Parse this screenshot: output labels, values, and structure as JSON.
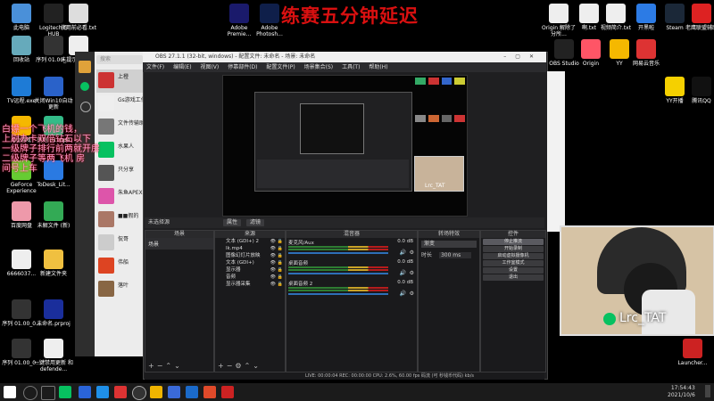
{
  "overlay": {
    "title": "练赛五分钟延迟"
  },
  "desktop_left": [
    {
      "label": "此电脑"
    },
    {
      "label": "Logitech G HUB"
    },
    {
      "label": "使用前必看.txt"
    },
    {
      "label": "回收站"
    },
    {
      "label": "序列 01.00_..."
    },
    {
      "label": "未提示页.mp4"
    },
    {
      "label": "TV远程.exe"
    },
    {
      "label": "关闭Win10自动更新"
    },
    {
      "label": "QQ游戏"
    },
    {
      "label": "序列 01.mp4"
    },
    {
      "label": "GeForce Experience"
    },
    {
      "label": "ToDesk_Lit..."
    },
    {
      "label": "百度网盘"
    },
    {
      "label": "未解文件 (新)"
    },
    {
      "label": "6666037..."
    },
    {
      "label": "新建文件夹"
    },
    {
      "label": "序列 01.00_0..."
    },
    {
      "label": "未命名.prproj"
    },
    {
      "label": "序列 01.00_0..."
    },
    {
      "label": "一键禁用更新 和defende..."
    }
  ],
  "desktop_top": [
    {
      "label": "Adobe Premie..."
    },
    {
      "label": "Adobe Photosh..."
    }
  ],
  "desktop_right": [
    {
      "label": "Origin 解除了分所..."
    },
    {
      "label": "啊.txt"
    },
    {
      "label": "视频简介.txt"
    },
    {
      "label": "开黑啦"
    },
    {
      "label": "Steam"
    },
    {
      "label": "老鹰联盟辅助"
    },
    {
      "label": "OBS Studio"
    },
    {
      "label": "Origin"
    },
    {
      "label": "YY"
    },
    {
      "label": "网易云音乐"
    },
    {
      "label": "YY开播"
    },
    {
      "label": "腾讯QQ"
    },
    {
      "label": "Launcher..."
    }
  ],
  "chat_overlay": {
    "lines": [
      "白嫖一个飞机的钱，",
      "上尉办卡双倍钻石以下",
      "一级牌子排行前两就开房",
      "二级牌子等两飞机 房",
      "间号上车"
    ]
  },
  "chat": {
    "search_placeholder": "搜索",
    "contacts": [
      "上橙",
      "Gs游戏工作室",
      "文件传输助",
      "水果人",
      "只分享",
      "朱鱼APEX",
      "■■假的",
      "侃哥",
      "伟船",
      "落叶"
    ]
  },
  "obs": {
    "title": "OBS 27.1.1 (32-bit, windows) - 配置文件: 未命名 - 场景: 未命名",
    "menu": [
      "文件(F)",
      "编辑(E)",
      "视图(V)",
      "停靠部件(D)",
      "配置文件(P)",
      "场景集合(S)",
      "工具(T)",
      "帮助(H)"
    ],
    "bottom_bar_label": "未选择源",
    "props_button": "属性",
    "filter_button": "滤镜",
    "docks": {
      "scenes": "场景",
      "sources": "来源",
      "mixer": "混音器",
      "transitions": "转场特效",
      "controls": "控件"
    },
    "scene_items": [
      "场景"
    ],
    "sources": [
      "文本 (GDI+) 2",
      "lk.mp4",
      "图像幻灯片放映",
      "文本 (GDI+)",
      "显示器",
      "音频",
      "显示器采集"
    ],
    "mixer": [
      {
        "name": "麦克风/Aux",
        "level": "0.0 dB"
      },
      {
        "name": "桌面音频",
        "level": "0.0 dB"
      },
      {
        "name": "桌面音频 2",
        "level": "0.0 dB"
      }
    ],
    "transition": {
      "type": "渐变",
      "duration_label": "时长",
      "duration": "300 ms"
    },
    "controls": [
      "停止推流",
      "开始录制",
      "启动虚拟摄像机",
      "工作室模式",
      "设置",
      "退出"
    ],
    "status": "LIVE: 00:00:04   REC: 00:00:00   CPU: 2.6%, 60.00 fps   码流 (可 秒钱币代码)   kb/s"
  },
  "webcam": {
    "name": "Lrc_TAT",
    "inner_name": "Lrc_TAT"
  },
  "taskbar": {
    "time": "17:54:43",
    "date": "2021/10/6"
  },
  "colors": {
    "overlay_red": "#d91010",
    "obs_bg": "#1f1f21",
    "wechat_green": "#07c160"
  }
}
